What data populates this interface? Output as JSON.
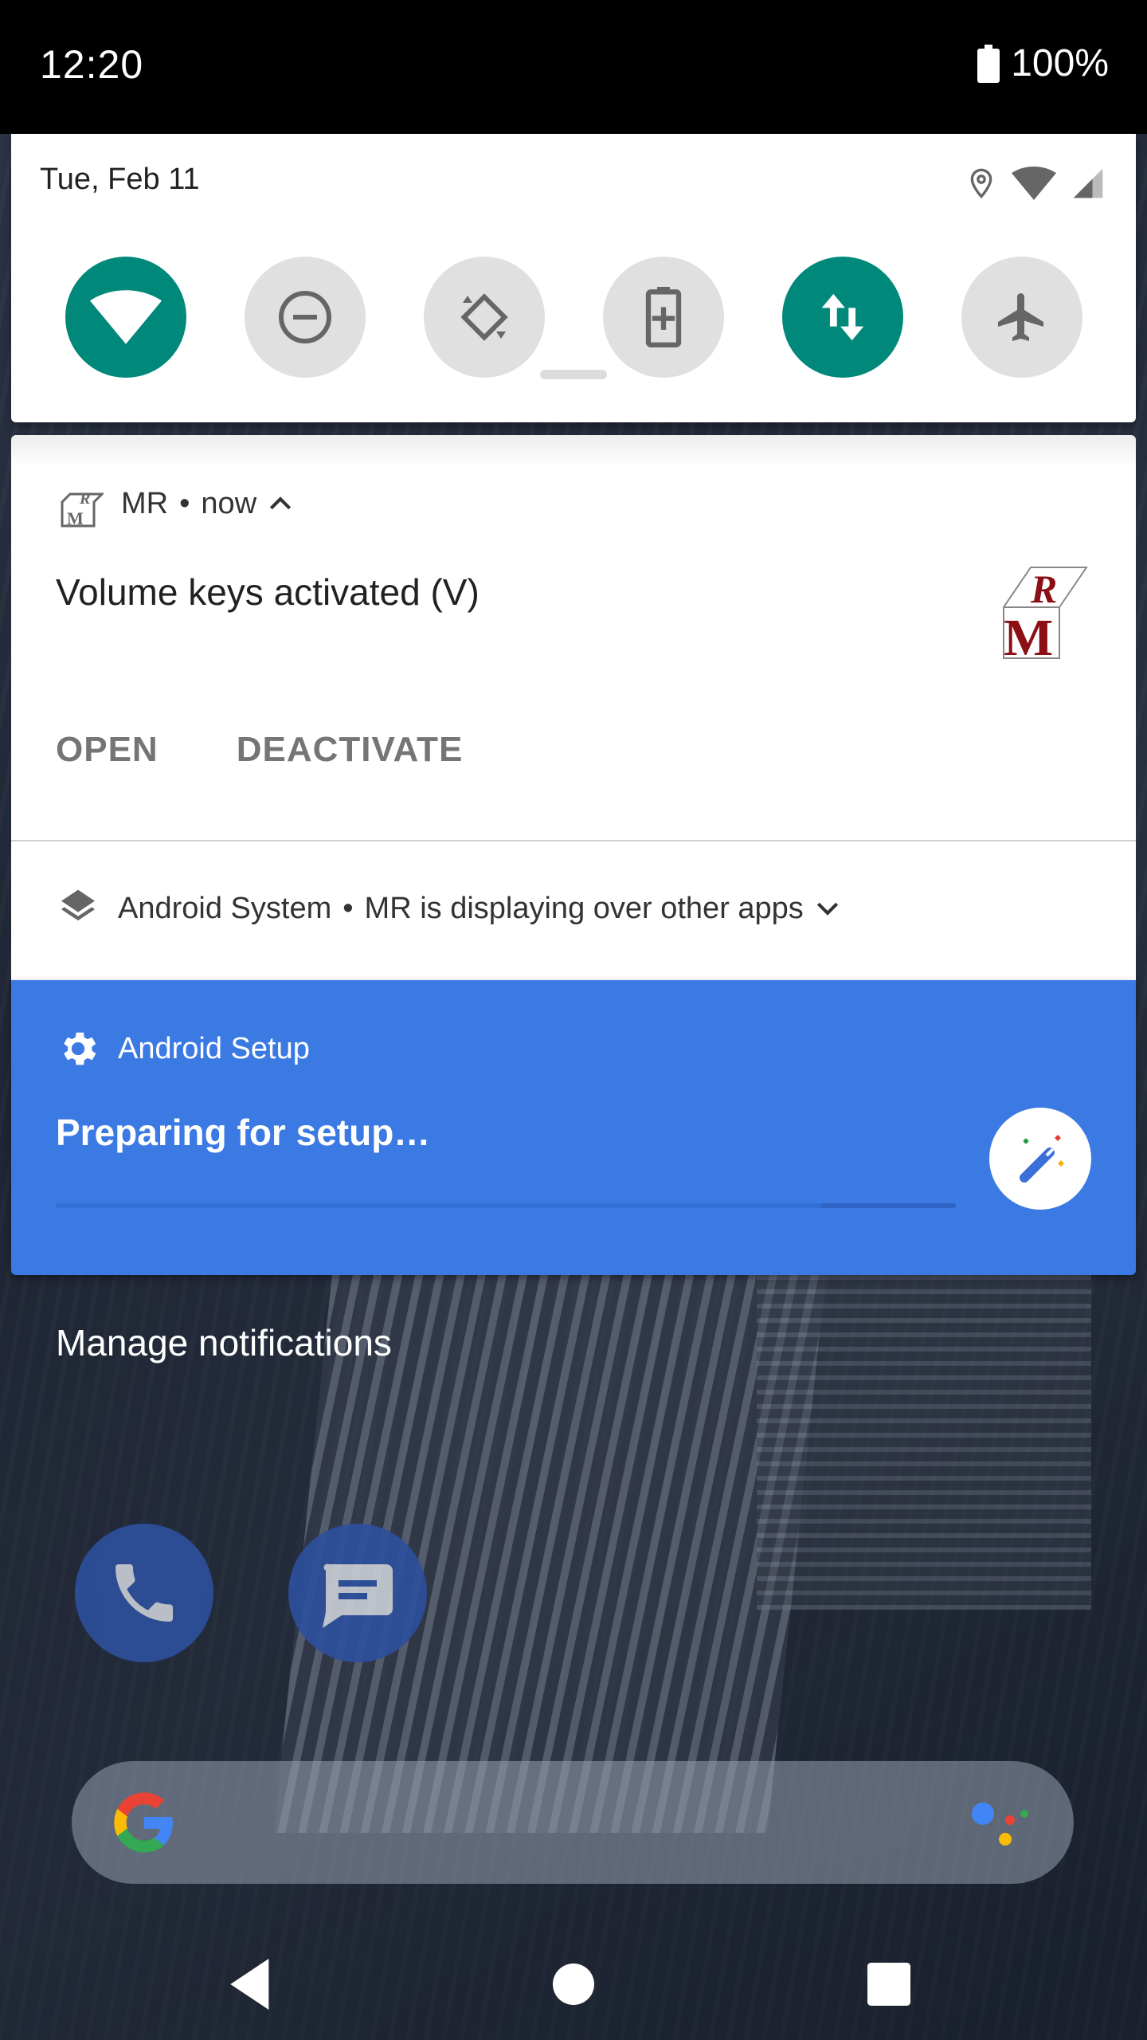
{
  "status_bar": {
    "time": "12:20",
    "battery_text": "100%"
  },
  "quick_settings": {
    "date": "Tue, Feb 11",
    "tiles": [
      {
        "id": "wifi",
        "icon": "wifi-icon",
        "on": true
      },
      {
        "id": "dnd",
        "icon": "do-not-disturb-icon",
        "on": false
      },
      {
        "id": "rotate",
        "icon": "auto-rotate-icon",
        "on": false
      },
      {
        "id": "battery-saver",
        "icon": "battery-saver-icon",
        "on": false
      },
      {
        "id": "mobile-data",
        "icon": "mobile-data-icon",
        "on": true
      },
      {
        "id": "airplane",
        "icon": "airplane-icon",
        "on": false
      }
    ],
    "status_icons": [
      "location-icon",
      "wifi-icon",
      "cell-signal-icon"
    ]
  },
  "notifications": {
    "mr": {
      "app_name": "MR",
      "separator": "•",
      "time": "now",
      "title": "Volume keys activated (V)",
      "actions": [
        "OPEN",
        "DEACTIVATE"
      ]
    },
    "system": {
      "app_name": "Android System",
      "separator": "•",
      "text": "MR is displaying over other apps"
    },
    "setup": {
      "app_name": "Android Setup",
      "title": "Preparing for setup…"
    }
  },
  "manage_notifications": "Manage notifications",
  "colors": {
    "tile_on": "#00897b",
    "tile_off": "#e0e0e0",
    "setup_blue": "#3b7ae3"
  }
}
